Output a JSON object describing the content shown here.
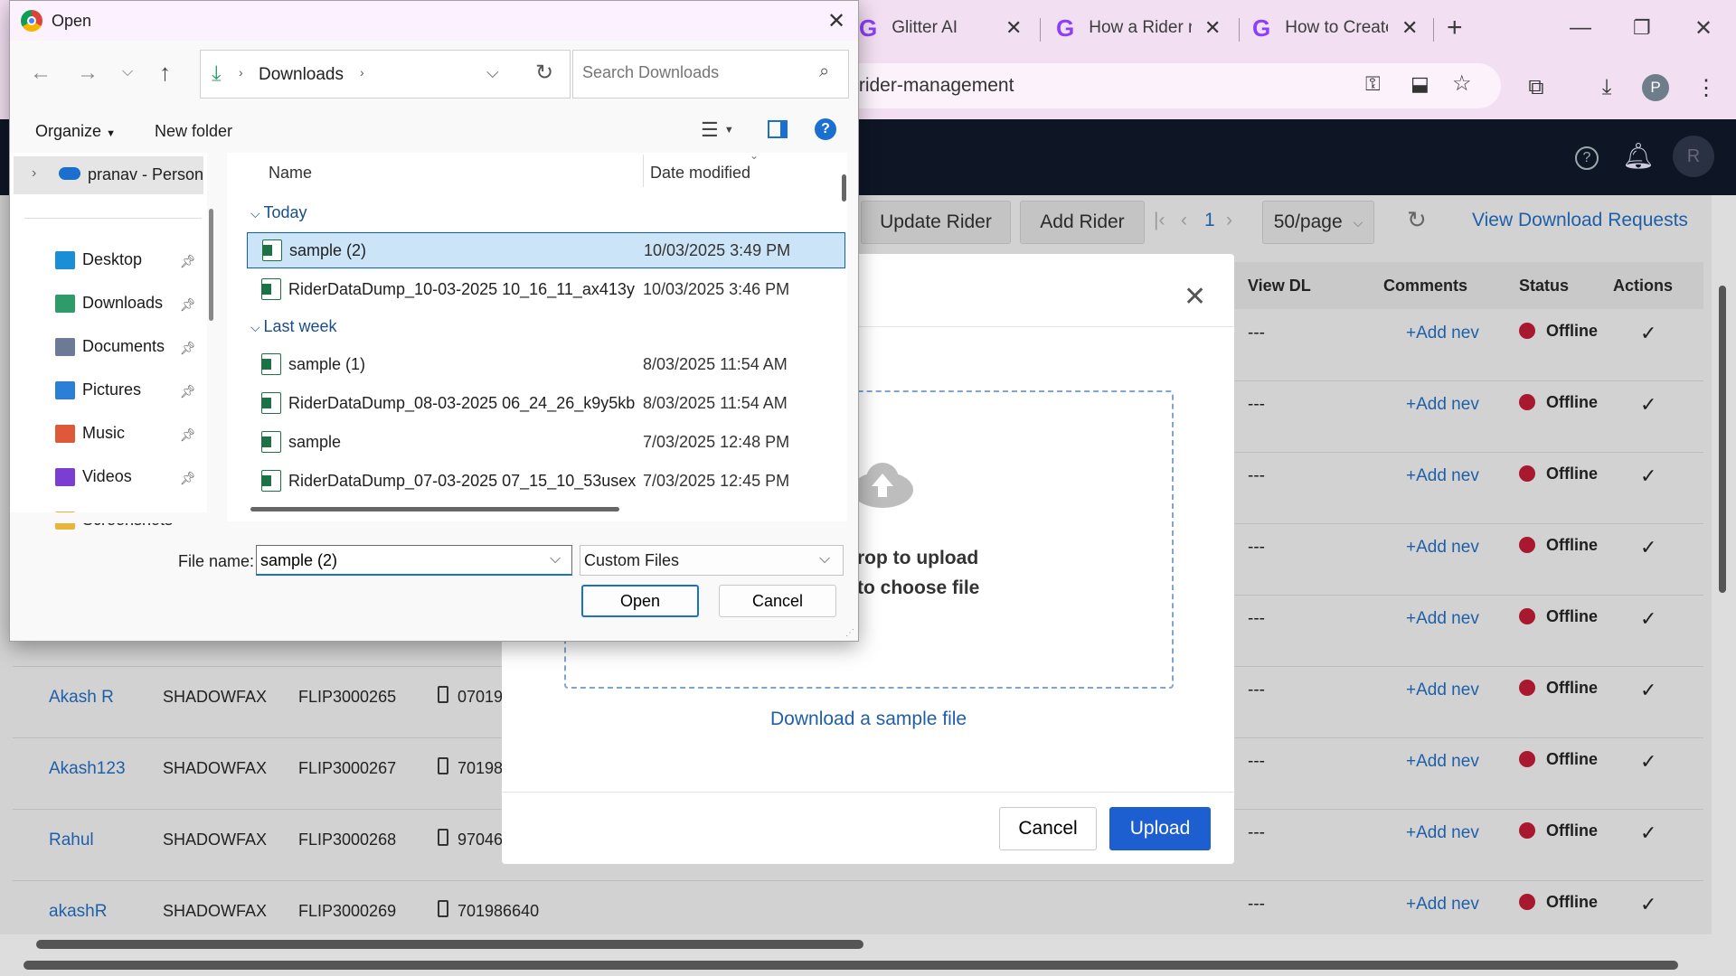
{
  "browser": {
    "tabs": [
      {
        "label": "Glitter AI"
      },
      {
        "label": "How a Rider r"
      },
      {
        "label": "How to Create"
      }
    ],
    "new_tab_label": "+",
    "url": "/rider-management",
    "profile_initial": "P"
  },
  "app": {
    "avatar_initial": "R",
    "toolbar": {
      "update_rider": "Update Rider",
      "add_rider": "Add Rider",
      "page_number": "1",
      "page_size": "50/page",
      "view_download_requests": "View Download Requests"
    },
    "columns": [
      "View DL",
      "Comments",
      "Status",
      "Actions"
    ],
    "rows": [
      {
        "name": "",
        "company": "",
        "code": "",
        "phone": "",
        "view_dl": "---",
        "comment": "+Add nev",
        "status": "Offline"
      },
      {
        "name": "",
        "company": "",
        "code": "",
        "phone": "",
        "view_dl": "---",
        "comment": "+Add nev",
        "status": "Offline"
      },
      {
        "name": "",
        "company": "",
        "code": "",
        "phone": "",
        "view_dl": "---",
        "comment": "+Add nev",
        "status": "Offline"
      },
      {
        "name": "",
        "company": "",
        "code": "",
        "phone": "",
        "view_dl": "---",
        "comment": "+Add nev",
        "status": "Offline"
      },
      {
        "name": "",
        "company": "",
        "code": "",
        "phone": "",
        "view_dl": "---",
        "comment": "+Add nev",
        "status": "Offline"
      },
      {
        "name": "Akash R",
        "company": "SHADOWFAX",
        "code": "FLIP3000265",
        "phone": "07019",
        "view_dl": "---",
        "comment": "+Add nev",
        "status": "Offline"
      },
      {
        "name": "Akash123",
        "company": "SHADOWFAX",
        "code": "FLIP3000267",
        "phone": "70198",
        "view_dl": "---",
        "comment": "+Add nev",
        "status": "Offline"
      },
      {
        "name": "Rahul",
        "company": "SHADOWFAX",
        "code": "FLIP3000268",
        "phone": "97046",
        "view_dl": "---",
        "comment": "+Add nev",
        "status": "Offline"
      },
      {
        "name": "akashR",
        "company": "SHADOWFAX",
        "code": "FLIP3000269",
        "phone": "701986640",
        "view_dl": "---",
        "comment": "+Add nev",
        "status": "Offline"
      }
    ],
    "upload_modal": {
      "drop_line1": "rop to upload",
      "drop_line2": "to choose file",
      "sample_link": "Download a sample file",
      "cancel": "Cancel",
      "upload": "Upload"
    }
  },
  "dialog": {
    "title": "Open",
    "breadcrumb": "Downloads",
    "search_placeholder": "Search Downloads",
    "organize": "Organize",
    "new_folder": "New folder",
    "onedrive": "pranav - Persona",
    "nav": [
      {
        "label": "Desktop",
        "icon": "desktop-icon",
        "color": "#1b8fd6"
      },
      {
        "label": "Downloads",
        "icon": "downloads-icon",
        "color": "#2e9b6a"
      },
      {
        "label": "Documents",
        "icon": "documents-icon",
        "color": "#6c7a96"
      },
      {
        "label": "Pictures",
        "icon": "pictures-icon",
        "color": "#2b7fd4"
      },
      {
        "label": "Music",
        "icon": "music-icon",
        "color": "#e0583a"
      },
      {
        "label": "Videos",
        "icon": "videos-icon",
        "color": "#7a3fd0"
      },
      {
        "label": "Screenshots",
        "icon": "folder-icon",
        "color": "#e8b538"
      }
    ],
    "col_name": "Name",
    "col_date": "Date modified",
    "groups": [
      {
        "label": "Today",
        "files": [
          {
            "name": "sample (2)",
            "date": "10/03/2025 3:49 PM",
            "selected": true
          },
          {
            "name": "RiderDataDump_10-03-2025 10_16_11_ax413y",
            "date": "10/03/2025 3:46 PM"
          }
        ]
      },
      {
        "label": "Last week",
        "files": [
          {
            "name": "sample (1)",
            "date": "8/03/2025 11:54 AM"
          },
          {
            "name": "RiderDataDump_08-03-2025 06_24_26_k9y5kb",
            "date": "8/03/2025 11:54 AM"
          },
          {
            "name": "sample",
            "date": "7/03/2025 12:48 PM"
          },
          {
            "name": "RiderDataDump_07-03-2025 07_15_10_53usex",
            "date": "7/03/2025 12:45 PM"
          }
        ]
      }
    ],
    "file_name_label": "File name:",
    "file_name_value": "sample (2)",
    "file_type": "Custom Files",
    "open": "Open",
    "cancel": "Cancel"
  }
}
